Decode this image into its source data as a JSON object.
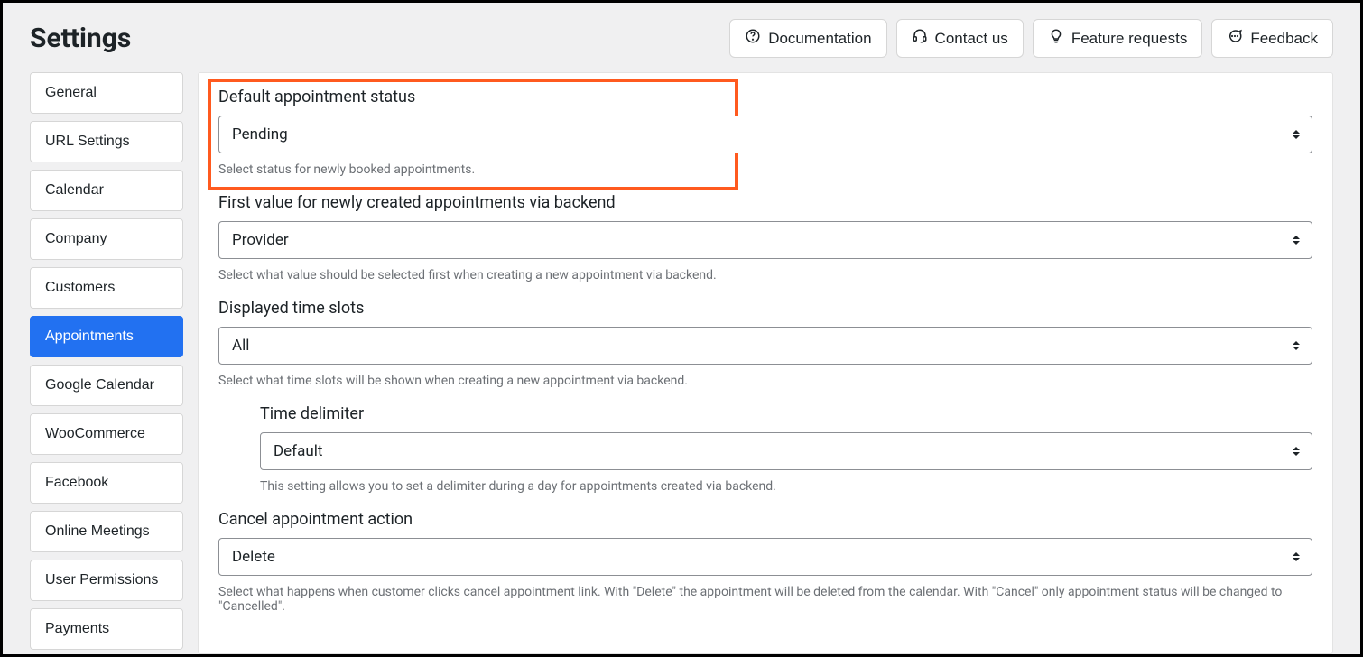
{
  "header": {
    "title": "Settings",
    "actions": {
      "documentation": "Documentation",
      "contact": "Contact us",
      "feature": "Feature requests",
      "feedback": "Feedback"
    }
  },
  "sidebar": {
    "items": [
      {
        "label": "General"
      },
      {
        "label": "URL Settings"
      },
      {
        "label": "Calendar"
      },
      {
        "label": "Company"
      },
      {
        "label": "Customers"
      },
      {
        "label": "Appointments",
        "active": true
      },
      {
        "label": "Google Calendar"
      },
      {
        "label": "WooCommerce"
      },
      {
        "label": "Facebook"
      },
      {
        "label": "Online Meetings"
      },
      {
        "label": "User Permissions"
      },
      {
        "label": "Payments"
      }
    ]
  },
  "fields": {
    "default_status": {
      "label": "Default appointment status",
      "value": "Pending",
      "help": "Select status for newly booked appointments."
    },
    "first_value": {
      "label": "First value for newly created appointments via backend",
      "value": "Provider",
      "help": "Select what value should be selected first when creating a new appointment via backend."
    },
    "displayed_slots": {
      "label": "Displayed time slots",
      "value": "All",
      "help": "Select what time slots will be shown when creating a new appointment via backend."
    },
    "time_delimiter": {
      "label": "Time delimiter",
      "value": "Default",
      "help": "This setting allows you to set a delimiter during a day for appointments created via backend."
    },
    "cancel_action": {
      "label": "Cancel appointment action",
      "value": "Delete",
      "help": "Select what happens when customer clicks cancel appointment link. With \"Delete\" the appointment will be deleted from the calendar. With \"Cancel\" only appointment status will be changed to \"Cancelled\"."
    }
  }
}
